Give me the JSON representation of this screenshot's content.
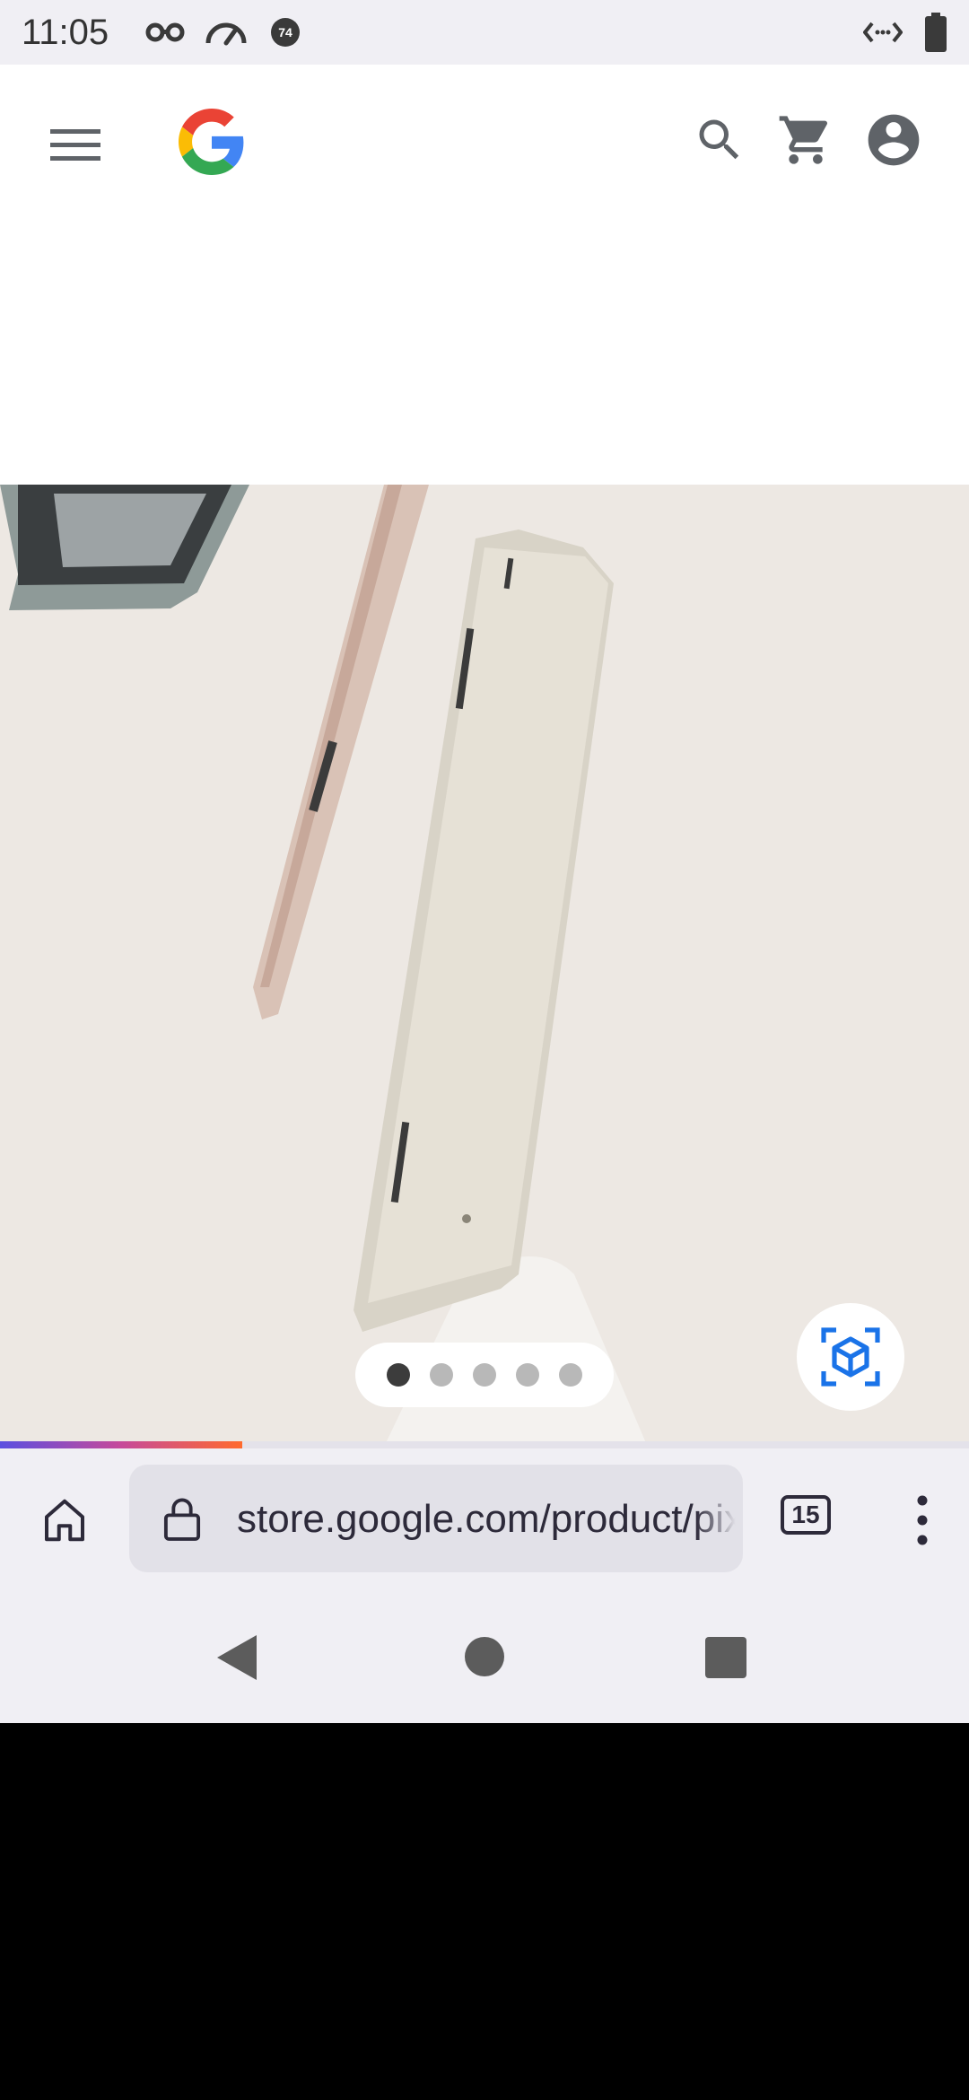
{
  "status_bar": {
    "time": "11:05",
    "badge_number": "74",
    "icons": [
      "incognito-icon",
      "speedometer-icon",
      "notification-badge-icon",
      "data-arrows-icon",
      "battery-icon"
    ]
  },
  "site_header": {
    "icons": [
      "hamburger-menu-icon",
      "google-logo",
      "search-icon",
      "cart-icon",
      "account-icon"
    ]
  },
  "carousel": {
    "slide_count": 5,
    "active_index": 0
  },
  "colors": {
    "hero_bg": "#ede8e3",
    "ar_icon": "#1a73e8",
    "google_blue": "#4285F4",
    "google_red": "#EA4335",
    "google_yellow": "#FBBC05",
    "google_green": "#34A853"
  },
  "page_load_progress": 0.25,
  "browser": {
    "url": "store.google.com/product/pixel_tablet",
    "tab_count": "15"
  }
}
